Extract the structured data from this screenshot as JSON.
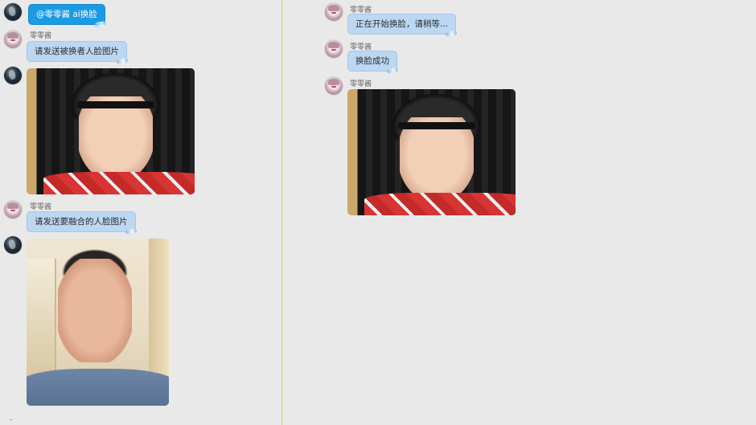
{
  "left": {
    "self_message": "@零零酱 ai换脸",
    "bot_name": "零零酱",
    "messages": [
      {
        "name": "零零酱",
        "text": "请发送被换者人脸图片"
      },
      {
        "name": "零零酱",
        "text": "请发送要融合的人脸图片"
      }
    ]
  },
  "right": {
    "messages": [
      {
        "name": "零零酱",
        "text": "正在开始换脸，请稍等..."
      },
      {
        "name": "零零酱",
        "text": "换脸成功"
      },
      {
        "name": "零零酱"
      }
    ]
  },
  "colors": {
    "self_bubble": "#1a9be4",
    "bot_bubble": "#bcd7f2",
    "background": "#e9e9e9",
    "divider": "#e6c65a"
  }
}
